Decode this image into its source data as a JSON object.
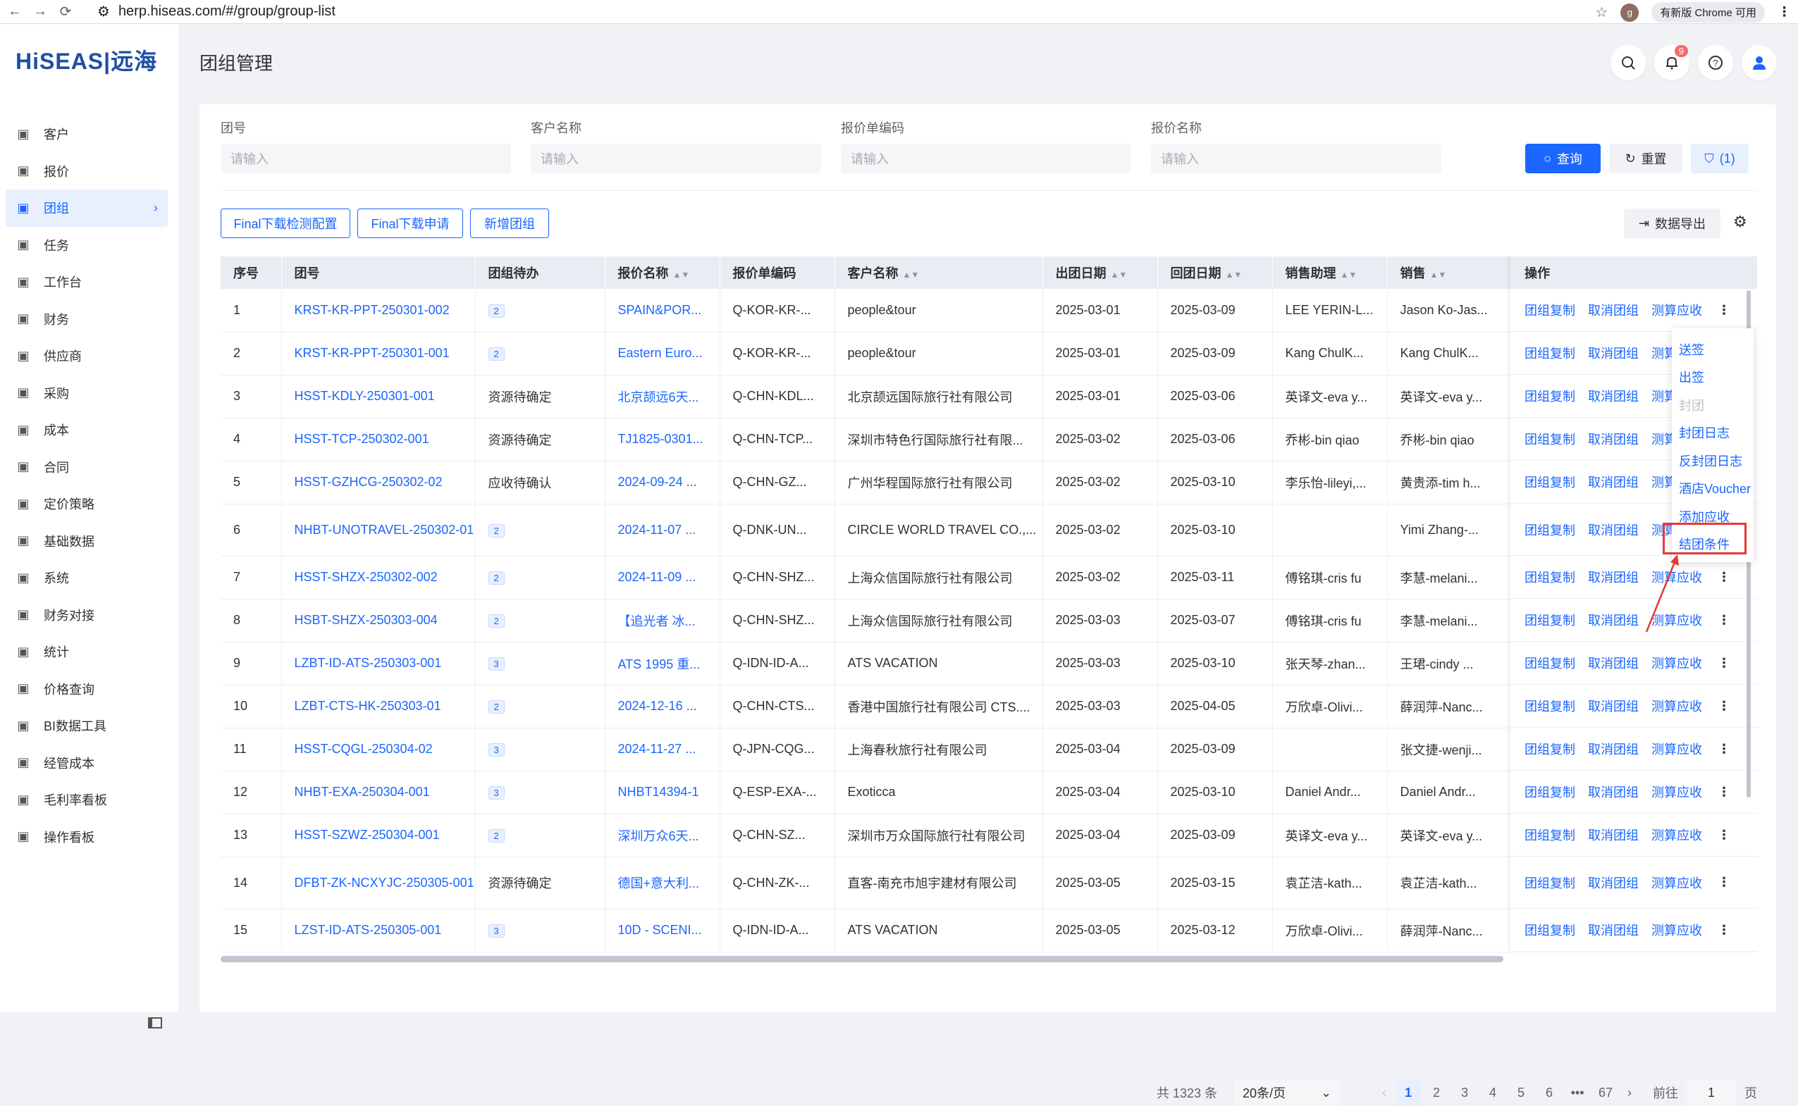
{
  "browser": {
    "url": "herp.hiseas.com/#/group/group-list",
    "profile": "g",
    "update_label": "有新版 Chrome 可用"
  },
  "logo": {
    "text": "HiSEAS|远海"
  },
  "sidebar": {
    "items": [
      {
        "label": "客户",
        "icon": "customer-icon"
      },
      {
        "label": "报价",
        "icon": "quote-icon"
      },
      {
        "label": "团组",
        "icon": "group-icon",
        "active": true
      },
      {
        "label": "任务",
        "icon": "task-icon"
      },
      {
        "label": "工作台",
        "icon": "workbench-icon"
      },
      {
        "label": "财务",
        "icon": "finance-icon"
      },
      {
        "label": "供应商",
        "icon": "supplier-icon"
      },
      {
        "label": "采购",
        "icon": "purchase-icon"
      },
      {
        "label": "成本",
        "icon": "cost-icon"
      },
      {
        "label": "合同",
        "icon": "contract-icon"
      },
      {
        "label": "定价策略",
        "icon": "pricing-icon"
      },
      {
        "label": "基础数据",
        "icon": "base-data-icon"
      },
      {
        "label": "系统",
        "icon": "system-icon"
      },
      {
        "label": "财务对接",
        "icon": "finance-link-icon"
      },
      {
        "label": "统计",
        "icon": "stats-icon"
      },
      {
        "label": "价格查询",
        "icon": "price-search-icon"
      },
      {
        "label": "BI数据工具",
        "icon": "bi-icon"
      },
      {
        "label": "经管成本",
        "icon": "mgmt-cost-icon"
      },
      {
        "label": "毛利率看板",
        "icon": "margin-board-icon"
      },
      {
        "label": "操作看板",
        "icon": "ops-board-icon"
      }
    ]
  },
  "header": {
    "title": "团组管理",
    "notification_count": "9"
  },
  "filters": {
    "group_no": {
      "label": "团号",
      "placeholder": "请输入"
    },
    "customer": {
      "label": "客户名称",
      "placeholder": "请输入"
    },
    "quote_code": {
      "label": "报价单编码",
      "placeholder": "请输入"
    },
    "quote_name": {
      "label": "报价名称",
      "placeholder": "请输入"
    },
    "search_label": "查询",
    "reset_label": "重置",
    "filter_label": "(1)"
  },
  "toolbar": {
    "btn1": "Final下载检测配置",
    "btn2": "Final下载申请",
    "btn3": "新增团组",
    "export_label": "数据导出"
  },
  "table": {
    "columns": [
      "序号",
      "团号",
      "团组待办",
      "报价名称",
      "报价单编码",
      "客户名称",
      "出团日期",
      "回团日期",
      "销售助理",
      "销售",
      "操作"
    ],
    "rows": [
      {
        "no": "1",
        "group": "KRST-KR-PPT-250301-002",
        "todo": "2",
        "quote": "SPAIN&POR...",
        "code": "Q-KOR-KR-...",
        "customer": "people&tour",
        "dep": "2025-03-01",
        "ret": "2025-03-09",
        "asst": "LEE YERIN-L...",
        "sales": "Jason Ko-Jas..."
      },
      {
        "no": "2",
        "group": "KRST-KR-PPT-250301-001",
        "todo": "2",
        "quote": "Eastern Euro...",
        "code": "Q-KOR-KR-...",
        "customer": "people&tour",
        "dep": "2025-03-01",
        "ret": "2025-03-09",
        "asst": "Kang ChulK...",
        "sales": "Kang ChulK..."
      },
      {
        "no": "3",
        "group": "HSST-KDLY-250301-001",
        "todo": "资源待确定",
        "quote": "北京颉远6天...",
        "code": "Q-CHN-KDL...",
        "customer": "北京颉远国际旅行社有限公司",
        "dep": "2025-03-01",
        "ret": "2025-03-06",
        "asst": "英译文-eva y...",
        "sales": "英译文-eva y..."
      },
      {
        "no": "4",
        "group": "HSST-TCP-250302-001",
        "todo": "资源待确定",
        "quote": "TJ1825-0301...",
        "code": "Q-CHN-TCP...",
        "customer": "深圳市特色行国际旅行社有限...",
        "dep": "2025-03-02",
        "ret": "2025-03-06",
        "asst": "乔彬-bin qiao",
        "sales": "乔彬-bin qiao"
      },
      {
        "no": "5",
        "group": "HSST-GZHCG-250302-02",
        "todo": "应收待确认",
        "quote": "2024-09-24 ...",
        "code": "Q-CHN-GZ...",
        "customer": "广州华程国际旅行社有限公司",
        "dep": "2025-03-02",
        "ret": "2025-03-10",
        "asst": "李乐怡-lileyi,...",
        "sales": "黄贵添-tim h..."
      },
      {
        "no": "6",
        "group": "NHBT-UNOTRAVEL-250302-01",
        "todo": "2",
        "quote": "2024-11-07 ...",
        "code": "Q-DNK-UN...",
        "customer": "CIRCLE WORLD TRAVEL CO.,...",
        "dep": "2025-03-02",
        "ret": "2025-03-10",
        "asst": "",
        "sales": "Yimi Zhang-..."
      },
      {
        "no": "7",
        "group": "HSST-SHZX-250302-002",
        "todo": "2",
        "quote": "2024-11-09 ...",
        "code": "Q-CHN-SHZ...",
        "customer": "上海众信国际旅行社有限公司",
        "dep": "2025-03-02",
        "ret": "2025-03-11",
        "asst": "傅铭琪-cris fu",
        "sales": "李慧-melani..."
      },
      {
        "no": "8",
        "group": "HSBT-SHZX-250303-004",
        "todo": "2",
        "quote": "【追光者 冰...",
        "code": "Q-CHN-SHZ...",
        "customer": "上海众信国际旅行社有限公司",
        "dep": "2025-03-03",
        "ret": "2025-03-07",
        "asst": "傅铭琪-cris fu",
        "sales": "李慧-melani..."
      },
      {
        "no": "9",
        "group": "LZBT-ID-ATS-250303-001",
        "todo": "3",
        "quote": "ATS 1995 重...",
        "code": "Q-IDN-ID-A...",
        "customer": "ATS VACATION",
        "dep": "2025-03-03",
        "ret": "2025-03-10",
        "asst": "张天琴-zhan...",
        "sales": "王珺-cindy ..."
      },
      {
        "no": "10",
        "group": "LZBT-CTS-HK-250303-01",
        "todo": "2",
        "quote": "2024-12-16 ...",
        "code": "Q-CHN-CTS...",
        "customer": "香港中国旅行社有限公司 CTS....",
        "dep": "2025-03-03",
        "ret": "2025-04-05",
        "asst": "万欣卓-Olivi...",
        "sales": "薛润萍-Nanc..."
      },
      {
        "no": "11",
        "group": "HSST-CQGL-250304-02",
        "todo": "3",
        "quote": "2024-11-27 ...",
        "code": "Q-JPN-CQG...",
        "customer": "上海春秋旅行社有限公司",
        "dep": "2025-03-04",
        "ret": "2025-03-09",
        "asst": "",
        "sales": "张文捷-wenji..."
      },
      {
        "no": "12",
        "group": "NHBT-EXA-250304-001",
        "todo": "3",
        "quote": "NHBT14394-1",
        "code": "Q-ESP-EXA-...",
        "customer": "Exoticca",
        "dep": "2025-03-04",
        "ret": "2025-03-10",
        "asst": "Daniel Andr...",
        "sales": "Daniel Andr..."
      },
      {
        "no": "13",
        "group": "HSST-SZWZ-250304-001",
        "todo": "2",
        "quote": "深圳万众6天...",
        "code": "Q-CHN-SZ...",
        "customer": "深圳市万众国际旅行社有限公司",
        "dep": "2025-03-04",
        "ret": "2025-03-09",
        "asst": "英译文-eva y...",
        "sales": "英译文-eva y..."
      },
      {
        "no": "14",
        "group": "DFBT-ZK-NCXYJC-250305-001",
        "todo": "资源待确定",
        "quote": "德国+意大利...",
        "code": "Q-CHN-ZK-...",
        "customer": "直客-南充市旭宇建材有限公司",
        "dep": "2025-03-05",
        "ret": "2025-03-15",
        "asst": "袁芷洁-kath...",
        "sales": "袁芷洁-kath..."
      },
      {
        "no": "15",
        "group": "LZST-ID-ATS-250305-001",
        "todo": "3",
        "quote": "10D - SCENI...",
        "code": "Q-IDN-ID-A...",
        "customer": "ATS VACATION",
        "dep": "2025-03-05",
        "ret": "2025-03-12",
        "asst": "万欣卓-Olivi...",
        "sales": "薛润萍-Nanc..."
      }
    ],
    "ops": [
      "团组复制",
      "取消团组",
      "测算应收"
    ],
    "ops_short": "测算"
  },
  "dropdown": {
    "items": [
      "送签",
      "出签",
      "封团",
      "封团日志",
      "反封团日志",
      "酒店Voucher",
      "添加应收",
      "结团条件"
    ]
  },
  "pagination": {
    "total": "共 1323 条",
    "page_size": "20条/页",
    "pages": [
      "1",
      "2",
      "3",
      "4",
      "5",
      "6",
      "•••",
      "67"
    ],
    "goto_label": "前往",
    "goto_value": "1",
    "page_suffix": "页"
  },
  "colors": {
    "primary": "#1a66ff",
    "highlight_box": "#e53935"
  }
}
